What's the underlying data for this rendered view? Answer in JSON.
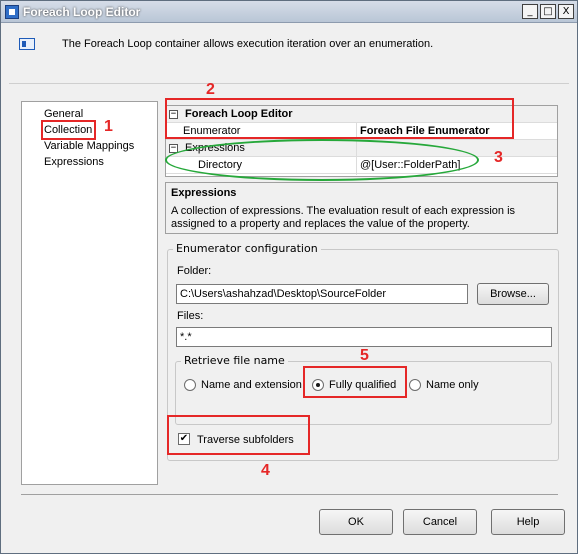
{
  "window": {
    "title": "Foreach Loop Editor",
    "controls": {
      "minimize": "_",
      "maximize": "□",
      "close": "X"
    }
  },
  "header": {
    "description": "The Foreach Loop container allows execution iteration over an enumeration."
  },
  "nav": {
    "items": [
      {
        "label": "General"
      },
      {
        "label": "Collection"
      },
      {
        "label": "Variable Mappings"
      },
      {
        "label": "Expressions"
      }
    ],
    "selected": "Collection"
  },
  "property_grid": {
    "category1": "Foreach Loop Editor",
    "enumerator_label": "Enumerator",
    "enumerator_value": "Foreach File Enumerator",
    "category2": "Expressions",
    "directory_label": "Directory",
    "directory_value": "@[User::FolderPath]",
    "expander_symbol": "−"
  },
  "description_panel": {
    "title": "Expressions",
    "body": "A collection of expressions. The evaluation result of each expression is assigned to a property and replaces the value of the property."
  },
  "enumerator_config": {
    "legend": "Enumerator configuration",
    "folder_label": "Folder:",
    "folder_value": "C:\\Users\\ashahzad\\Desktop\\SourceFolder",
    "browse_label": "Browse...",
    "files_label": "Files:",
    "files_value": "*.*",
    "retrieve": {
      "legend": "Retrieve file name",
      "options": [
        "Name and extension",
        "Fully qualified",
        "Name only"
      ],
      "selected": "Fully qualified"
    },
    "traverse_label": "Traverse subfolders",
    "traverse_checked": true,
    "check_glyph": "✔"
  },
  "footer": {
    "ok_label": "OK",
    "cancel_label": "Cancel",
    "help_label": "Help"
  },
  "annotations": {
    "numbers": [
      "1",
      "2",
      "3",
      "4",
      "5"
    ],
    "box_color": "#e52727",
    "ellipse_color": "#26a83a"
  }
}
